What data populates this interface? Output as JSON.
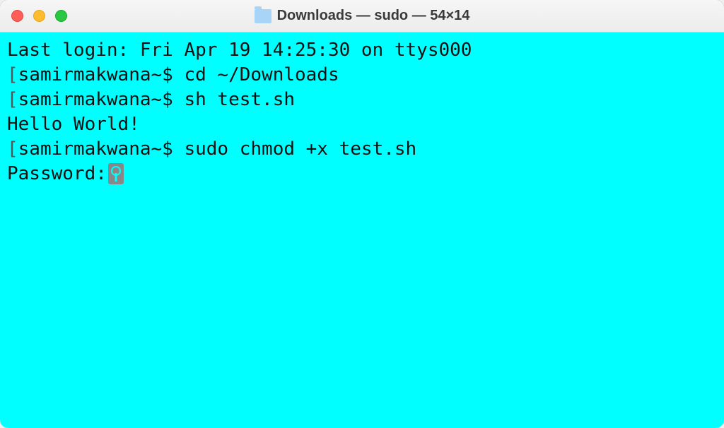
{
  "titlebar": {
    "title": "Downloads — sudo — 54×14"
  },
  "terminal": {
    "last_login": "Last login: Fri Apr 19 14:25:30 on ttys000",
    "lines": [
      {
        "prompt": "samirmakwana~$ ",
        "command": "cd ~/Downloads"
      },
      {
        "prompt": "samirmakwana~$ ",
        "command": "sh test.sh"
      }
    ],
    "output1": "Hello World!",
    "line3": {
      "prompt": "samirmakwana~$ ",
      "command": "sudo chmod +x test.sh"
    },
    "password_label": "Password:",
    "icon_name": "key-icon"
  },
  "colors": {
    "terminal_bg": "#00ffff",
    "text": "#111111"
  }
}
